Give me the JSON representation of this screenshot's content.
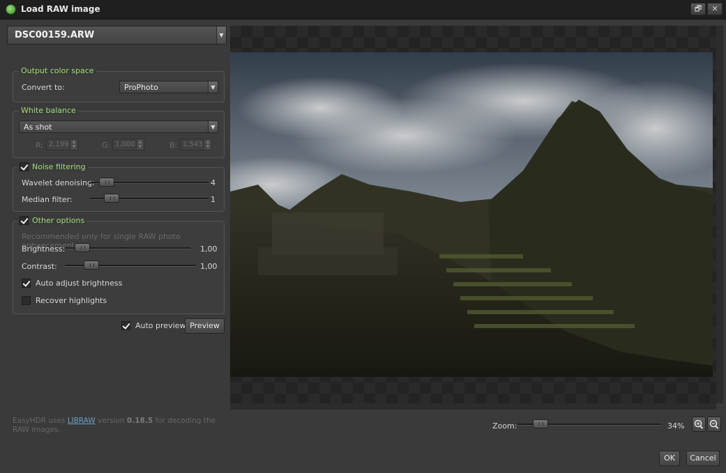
{
  "window": {
    "title": "Load RAW image",
    "restore_glyph": "🗗",
    "close_glyph": "✕"
  },
  "file": {
    "selected": "DSC00159.ARW"
  },
  "output_color_space": {
    "legend": "Output color space",
    "convert_label": "Convert to:",
    "convert_value": "ProPhoto"
  },
  "white_balance": {
    "legend": "White balance",
    "mode": "As shot",
    "r_label": "R:",
    "r_value": "2,199",
    "g_label": "G:",
    "g_value": "1,000",
    "b_label": "B:",
    "b_value": "1,543"
  },
  "noise_filtering": {
    "legend": "Noise filtering",
    "enabled": true,
    "wavelet_label": "Wavelet denoising:",
    "wavelet_value": "4",
    "wavelet_level": 0.14,
    "median_label": "Median filter:",
    "median_value": "1",
    "median_level": 0.18
  },
  "other_options": {
    "legend": "Other options",
    "enabled": true,
    "note": "Recommended only for single RAW photo enhancement",
    "brightness_label": "Brightness:",
    "brightness_value": "1,00",
    "contrast_label": "Contrast:",
    "contrast_value": "1,00",
    "auto_adjust_label": "Auto adjust brightness",
    "auto_adjust_checked": true,
    "recover_label": "Recover highlights",
    "recover_checked": false
  },
  "preview": {
    "auto_label": "Auto preview",
    "auto_checked": true,
    "button_label": "Preview"
  },
  "footer": {
    "prefix": "EasyHDR uses ",
    "link": "LIBRAW",
    "middle": " version ",
    "version": "0.18.5",
    "suffix": " for decoding the RAW images."
  },
  "zoom": {
    "label": "Zoom:",
    "value": "34%",
    "level": 0.16
  },
  "actions": {
    "ok_label": "OK",
    "cancel_label": "Cancel"
  },
  "icons": {
    "dropdown": "chevron-down-icon",
    "zoom_in": "zoom-in-icon",
    "zoom_out": "zoom-out-icon"
  }
}
